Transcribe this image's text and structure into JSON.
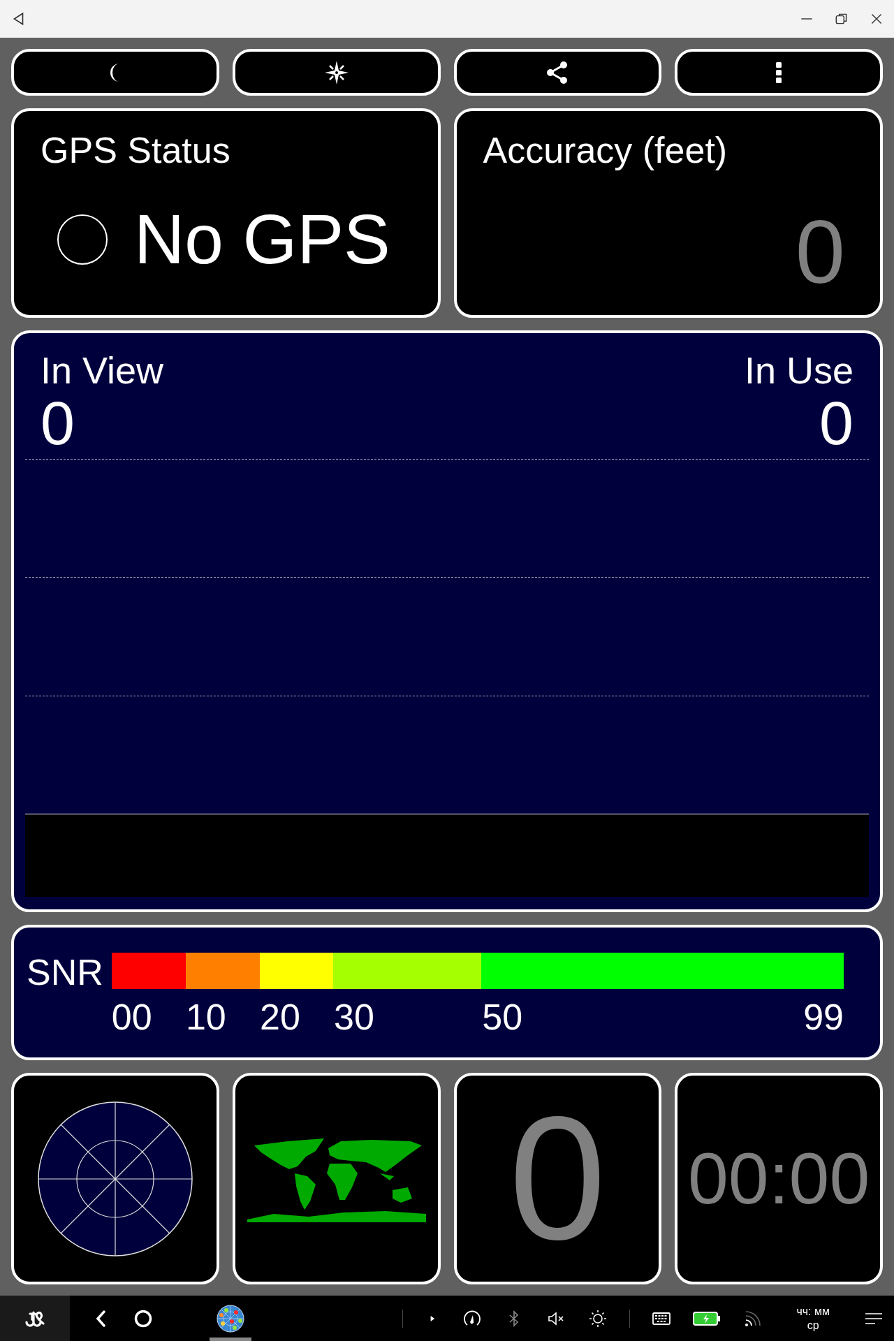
{
  "toolbar": {
    "buttons": [
      {
        "kind": "night"
      },
      {
        "kind": "compass"
      },
      {
        "kind": "share"
      },
      {
        "kind": "more"
      }
    ]
  },
  "gps_status": {
    "title": "GPS Status",
    "value": "No GPS"
  },
  "accuracy": {
    "title": "Accuracy (feet)",
    "value": "0"
  },
  "satellites": {
    "in_view_label": "In View",
    "in_view": "0",
    "in_use_label": "In Use",
    "in_use": "0"
  },
  "snr": {
    "label": "SNR",
    "segments": [
      {
        "color": "#ff0000",
        "label": "00"
      },
      {
        "color": "#ff8000",
        "label": "10"
      },
      {
        "color": "#ffff00",
        "label": "20"
      },
      {
        "color": "#a6ff00",
        "label": "30"
      },
      {
        "color": "#00ff00",
        "label": "50"
      }
    ],
    "end_label": "99"
  },
  "tiles": [
    {
      "kind": "skyplot"
    },
    {
      "kind": "worldmap"
    },
    {
      "kind": "number",
      "value": "0"
    },
    {
      "kind": "time",
      "value": "00:00"
    }
  ],
  "taskbar": {
    "clock_time": "чч: мм",
    "clock_day": "ср"
  }
}
